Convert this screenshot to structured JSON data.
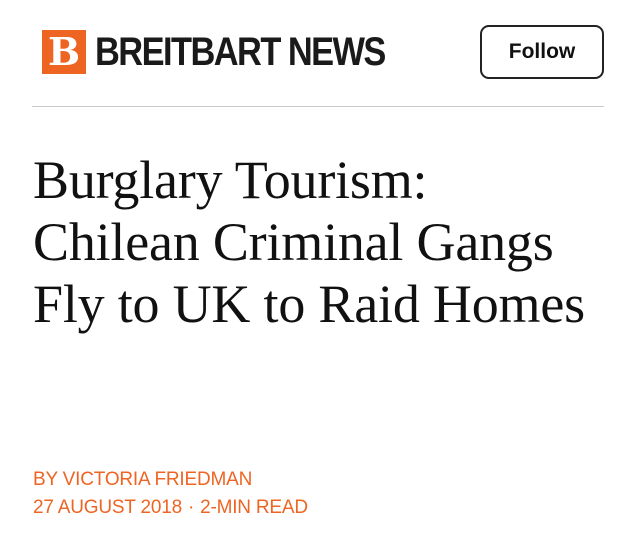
{
  "header": {
    "logo_letter": "B",
    "brand_name": "BREITBART NEWS",
    "follow_label": "Follow"
  },
  "article": {
    "title": "Burglary Tourism: Chilean Criminal Gangs Fly to UK to Raid Homes",
    "byline": "BY VICTORIA FRIEDMAN",
    "date": "27 AUGUST 2018",
    "separator": "·",
    "read_time": "2-MIN READ"
  },
  "colors": {
    "accent": "#ee6523",
    "text": "#111111",
    "divider": "#c9c9c9"
  }
}
